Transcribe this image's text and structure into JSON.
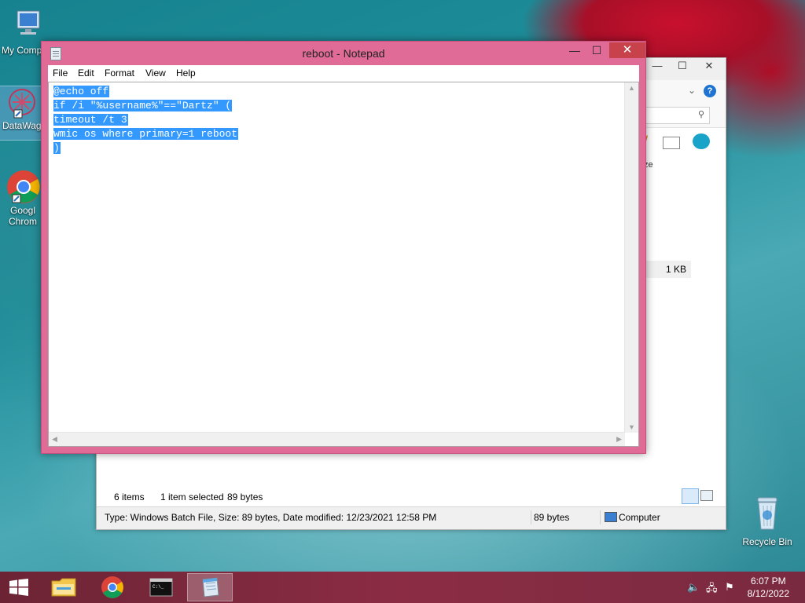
{
  "desktop": {
    "icons": [
      {
        "label": "My Comp"
      },
      {
        "label": "DataWag"
      },
      {
        "label": "Googl\nChrom"
      },
      {
        "label": "Recycle Bin"
      }
    ]
  },
  "explorer": {
    "status_items": "6 items",
    "status_selected": "1 item selected",
    "status_selected_size": "89 bytes",
    "file_size_cell": "1 KB",
    "ribbon_partial_label": "ze",
    "details_text": "Type: Windows Batch File, Size: 89 bytes, Date modified: 12/23/2021 12:58 PM",
    "details_size": "89 bytes",
    "details_location": "Computer"
  },
  "notepad": {
    "title": "reboot - Notepad",
    "menu": [
      "File",
      "Edit",
      "Format",
      "View",
      "Help"
    ],
    "lines": [
      "@echo off",
      "if /i \"%username%\"==\"Dartz\" (",
      "timeout /t 3",
      "wmic os where primary=1 reboot",
      ")"
    ]
  },
  "taskbar": {
    "time": "6:07 PM",
    "date": "8/12/2022",
    "apps": [
      "File Explorer",
      "Google Chrome",
      "Command Prompt",
      "Notepad"
    ]
  }
}
